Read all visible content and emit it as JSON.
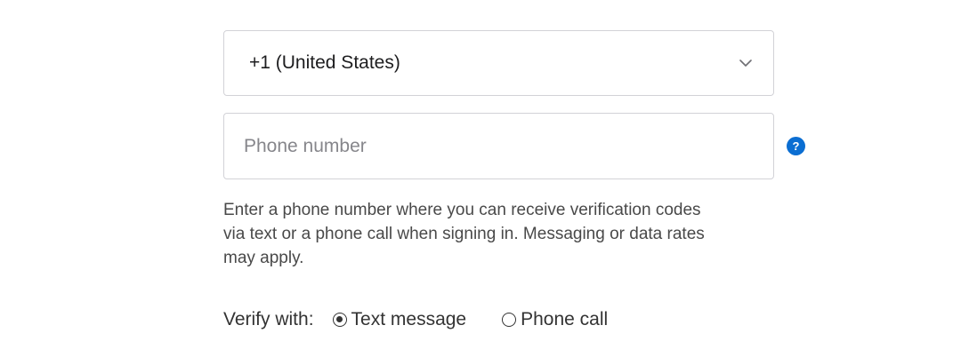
{
  "country_select": {
    "value": "+1 (United States)",
    "chevron_icon": "chevron-down-icon"
  },
  "phone": {
    "placeholder": "Phone number",
    "value": "",
    "help_icon": "question-icon",
    "help_glyph": "?"
  },
  "hint": "Enter a phone number where you can receive verification codes via text or a phone call when signing in. Messaging or data rates may apply.",
  "verify": {
    "label": "Verify with:",
    "options": [
      {
        "label": "Text message",
        "selected": true
      },
      {
        "label": "Phone call",
        "selected": false
      }
    ]
  },
  "colors": {
    "help_icon_bg": "#0b6ed2",
    "border": "#d2d2d7",
    "placeholder": "#86868b"
  }
}
